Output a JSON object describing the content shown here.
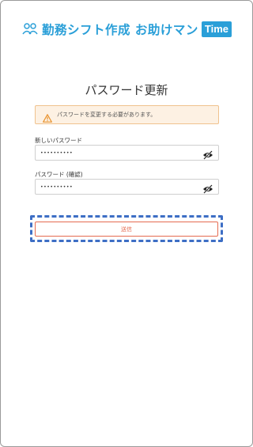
{
  "header": {
    "brand_text": "勤務シフト作成 お助けマン",
    "brand_badge": "Time",
    "logo_icon": "people-icon",
    "accent_color": "#2a9fd8"
  },
  "form": {
    "title": "パスワード更新",
    "alert": {
      "icon": "warning-icon",
      "text": "パスワードを変更する必要があります。"
    },
    "new_password": {
      "label": "新しいパスワード",
      "value": "••••••••••",
      "toggle_icon": "eye-off-icon"
    },
    "confirm_password": {
      "label": "パスワード (確認)",
      "value": "••••••••••",
      "toggle_icon": "eye-off-icon"
    },
    "submit_label": "送信",
    "submit_color": "#e56b50",
    "highlight_color": "#3d6ec5"
  }
}
